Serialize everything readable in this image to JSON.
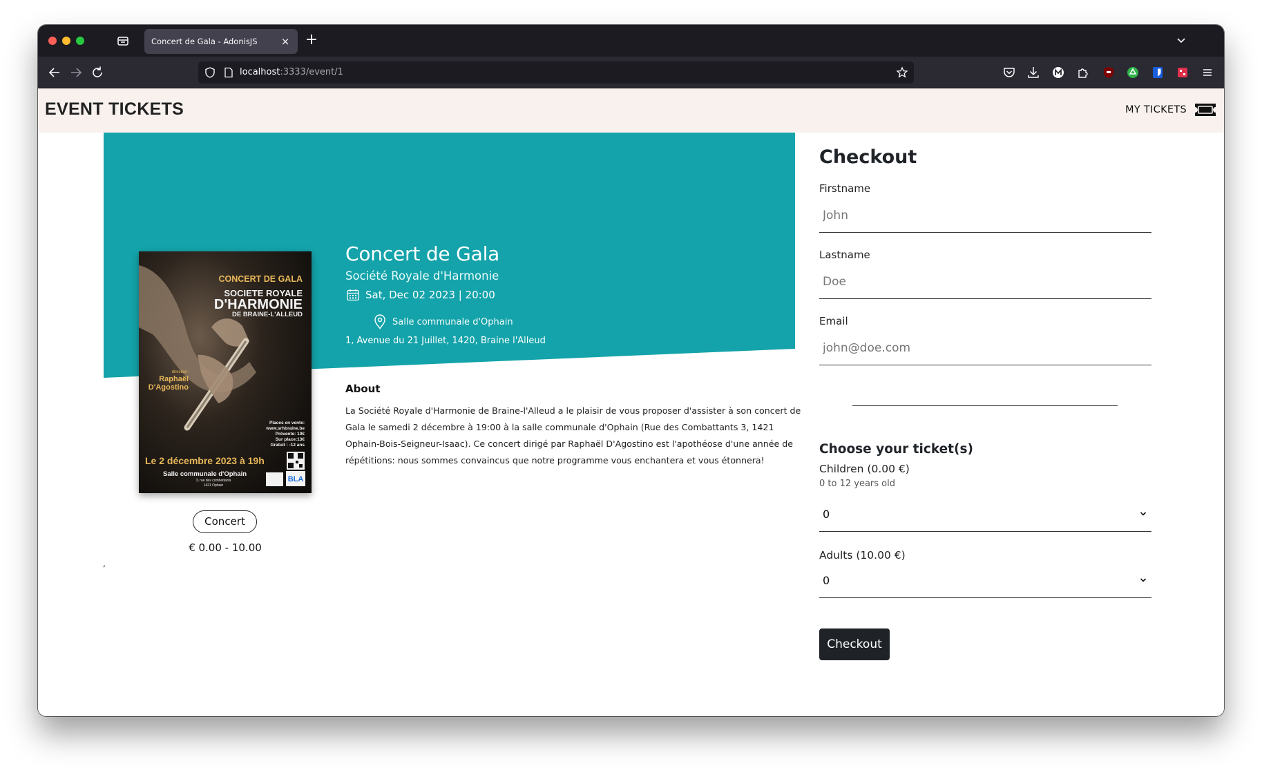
{
  "browser": {
    "tab_title": "Concert de Gala - AdonisJS",
    "tab_close": "×",
    "new_tab": "+",
    "url_host": "localhost",
    "url_path": ":3333/event/1"
  },
  "header": {
    "brand": "EVENT TICKETS",
    "my_tickets": "MY TICKETS"
  },
  "event": {
    "title": "Concert de Gala",
    "organizer": "Société Royale d'Harmonie",
    "date": "Sat, Dec 02 2023 | 20:00",
    "venue": "Salle communale d'Ophain",
    "address": "1, Avenue du 21 Juillet, 1420, Braine l'Alleud",
    "category": "Concert",
    "price_range": "€ 0.00 - 10.00",
    "stray_mark": ",",
    "about_title": "About",
    "about_text": "La Société Royale d'Harmonie de Braine-l'Alleud a le plaisir de vous proposer d'assister à son concert de Gala le samedi 2 décembre à 19:00 à la salle communale d'Ophain (Rue des Combattants 3, 1421 Ophain-Bois-Seigneur-Isaac). Ce concert dirigé par Raphaël D'Agostino est l'apothéose d'une année de répétitions: nous sommes convaincus que notre programme vous enchantera et vous étonnera!",
    "hero_color": "#14a3aa"
  },
  "poster": {
    "heading": "CONCERT DE GALA",
    "line1": "SOCIETE ROYALE",
    "line2": "D'HARMONIE",
    "line3": "DE BRAINE-L'ALLEUD",
    "direction_label": "direction:",
    "director_first": "Raphaël",
    "director_last": "D'Agostino",
    "sale_1": "Places en vente:",
    "sale_2": "www.srhbraine.be",
    "sale_3": "Prévente: 10€",
    "sale_4": "Sur place:13€",
    "sale_5": "Gratuit : -12 ans",
    "date_line": "Le 2 décembre 2023 à 19h",
    "venue_line": "Salle communale d'Ophain",
    "venue_street": "3, rue des combattants",
    "venue_city": "1421 Ophain",
    "logo_text": "BLA"
  },
  "checkout": {
    "title": "Checkout",
    "firstname_label": "Firstname",
    "firstname_placeholder": "John",
    "lastname_label": "Lastname",
    "lastname_placeholder": "Doe",
    "email_label": "Email",
    "email_placeholder": "john@doe.com",
    "tickets_title": "Choose your ticket(s)",
    "tickets": [
      {
        "name": "Children (0.00 €)",
        "description": "0 to 12 years old",
        "quantity": "0"
      },
      {
        "name": "Adults (10.00 €)",
        "quantity": "0"
      }
    ],
    "button_label": "Checkout"
  }
}
